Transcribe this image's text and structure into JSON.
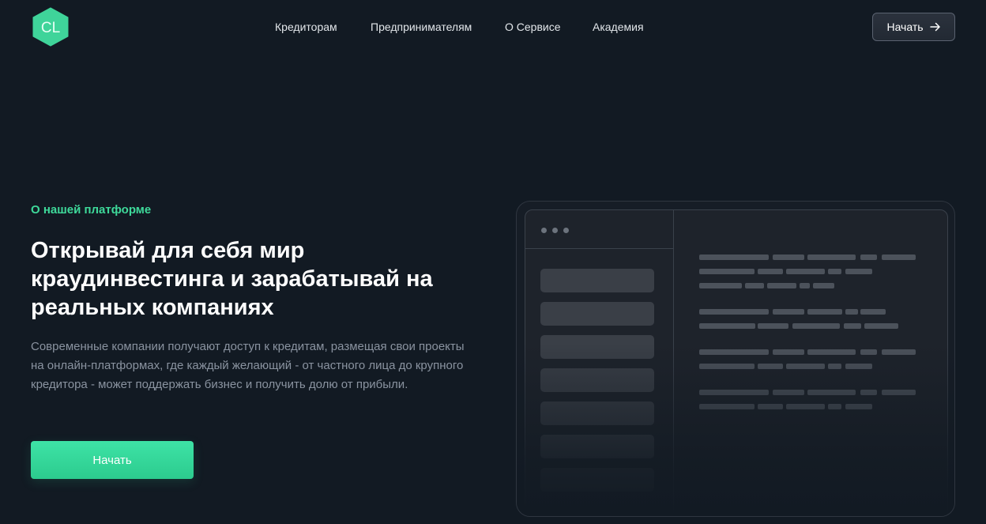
{
  "header": {
    "logo_text": "CL",
    "nav": [
      {
        "label": "Кредиторам"
      },
      {
        "label": "Предпринимателям"
      },
      {
        "label": "О Сервисе"
      },
      {
        "label": "Академия"
      }
    ],
    "start_button_label": "Начать",
    "start_button_icon": "arrow-right-icon"
  },
  "hero": {
    "eyebrow": "О нашей платформе",
    "title": "Открывай для себя мир краудинвестинга и зарабатывай на реальных компаниях",
    "description": "Современные компании получают доступ к кредитам, размещая свои проекты на онлайн-платформах, где каждый желающий - от частного лица до крупного кредитора - может поддержать бизнес и получить долю от прибыли.",
    "cta_label": "Начать"
  },
  "colors": {
    "background": "#121a23",
    "accent": "#3ed99a",
    "muted_text": "#8a93a0"
  }
}
